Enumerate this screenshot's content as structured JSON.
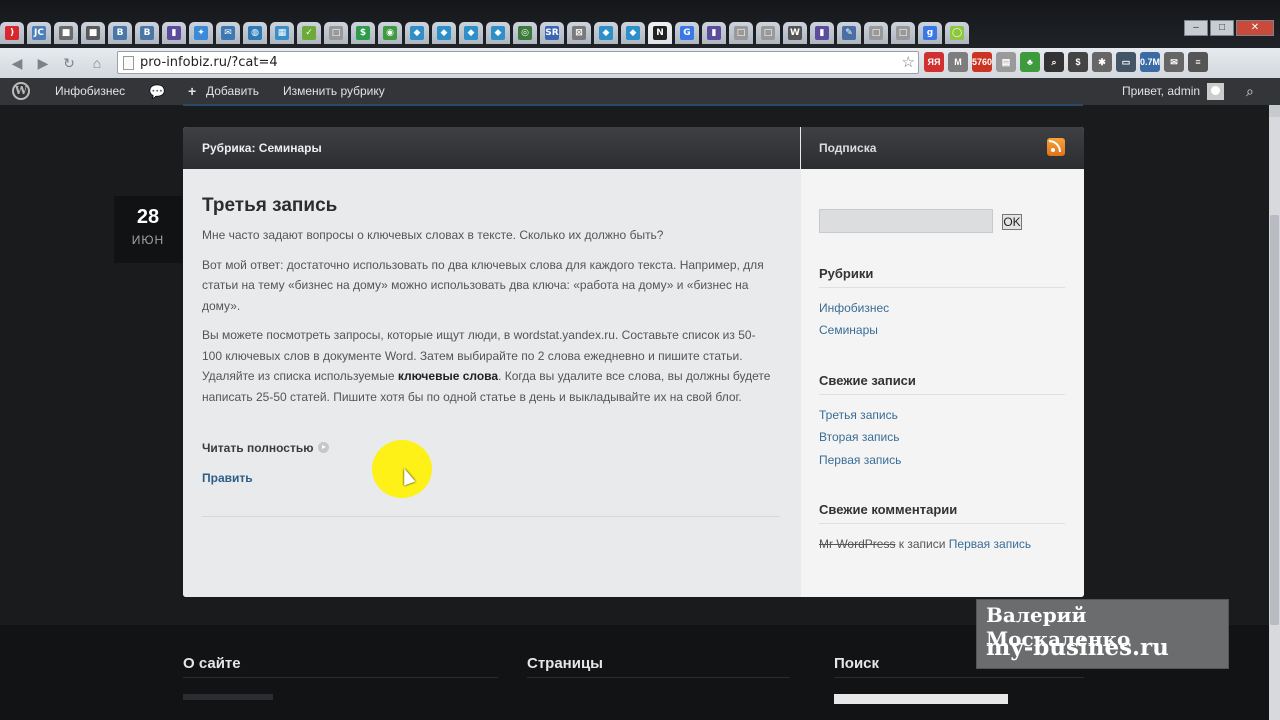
{
  "browser": {
    "tabs": [
      {
        "icon": "opera-icon",
        "glyph": ")",
        "color": "#d8272d"
      },
      {
        "icon": "jc-icon",
        "glyph": "JC",
        "color": "#4d7fb8"
      },
      {
        "icon": "photo-icon",
        "glyph": "■",
        "color": "#6a6a6a"
      },
      {
        "icon": "photo-icon-2",
        "glyph": "■",
        "color": "#5a5a5a"
      },
      {
        "icon": "vk-icon",
        "glyph": "В",
        "color": "#4a76a8"
      },
      {
        "icon": "vk-icon-2",
        "glyph": "В",
        "color": "#4a76a8"
      },
      {
        "icon": "liveinternet-icon",
        "glyph": "▮",
        "color": "#5c4c9c"
      },
      {
        "icon": "google-apps-icon",
        "glyph": "✦",
        "color": "#3b8ad8"
      },
      {
        "icon": "mail-icon",
        "glyph": "✉",
        "color": "#3c78b4"
      },
      {
        "icon": "globe-icon",
        "glyph": "◍",
        "color": "#2c7bb6"
      },
      {
        "icon": "grid-icon",
        "glyph": "▦",
        "color": "#3a8fc9"
      },
      {
        "icon": "leaf-icon",
        "glyph": "✓",
        "color": "#6cab39"
      },
      {
        "icon": "blank-page-icon",
        "glyph": "□",
        "color": "#999999"
      },
      {
        "icon": "dollar-icon",
        "glyph": "$",
        "color": "#2e9b4d"
      },
      {
        "icon": "lock-icon",
        "glyph": "◉",
        "color": "#3f9b40"
      },
      {
        "icon": "diamond-icon",
        "glyph": "◆",
        "color": "#2f8fc9"
      },
      {
        "icon": "diamond-icon-2",
        "glyph": "◆",
        "color": "#2f8fc9"
      },
      {
        "icon": "diamond-icon-3",
        "glyph": "◆",
        "color": "#2f8fc9"
      },
      {
        "icon": "diamond-icon-4",
        "glyph": "◆",
        "color": "#2f8fc9"
      },
      {
        "icon": "camera-icon",
        "glyph": "◎",
        "color": "#3d7a3b"
      },
      {
        "icon": "sr-icon",
        "glyph": "SR",
        "color": "#3a66b3"
      },
      {
        "icon": "cart-icon",
        "glyph": "⊠",
        "color": "#7a7a7a"
      },
      {
        "icon": "diamond-icon-5",
        "glyph": "◆",
        "color": "#2f8fc9"
      },
      {
        "icon": "diamond-icon-6",
        "glyph": "◆",
        "color": "#2f8fc9"
      },
      {
        "icon": "nw-icon",
        "glyph": "N",
        "color": "#222222"
      },
      {
        "icon": "google-icon",
        "glyph": "G",
        "color": "#3b78e7"
      },
      {
        "icon": "liveinternet-icon-2",
        "glyph": "▮",
        "color": "#5c4c9c"
      },
      {
        "icon": "blank-page-icon-2",
        "glyph": "□",
        "color": "#999999"
      },
      {
        "icon": "blank-page-icon-3",
        "glyph": "□",
        "color": "#999999"
      },
      {
        "icon": "wordpress-tab-icon",
        "glyph": "W",
        "color": "#555555"
      },
      {
        "icon": "liveinternet-icon-3",
        "glyph": "▮",
        "color": "#5c4c9c"
      },
      {
        "icon": "quill-icon",
        "glyph": "✎",
        "color": "#4a6fa5"
      },
      {
        "icon": "blank-page-icon-4",
        "glyph": "□",
        "color": "#999999"
      },
      {
        "icon": "blank-page-icon-5",
        "glyph": "□",
        "color": "#999999"
      },
      {
        "icon": "google-plus-icon",
        "glyph": "g",
        "color": "#3b78e7"
      },
      {
        "icon": "lime-icon",
        "glyph": "◯",
        "color": "#8ec63f"
      }
    ],
    "url": "pro-infobiz.ru/?cat=4",
    "extensions": [
      {
        "icon": "yandex-bar-icon",
        "glyph": "ЯЯ",
        "color": "#d03030"
      },
      {
        "icon": "gmail-icon",
        "glyph": "M",
        "color": "#7d7d7d"
      },
      {
        "icon": "counter-icon",
        "glyph": "5760",
        "color": "#cc3322"
      },
      {
        "icon": "page-ext-icon",
        "glyph": "▤",
        "color": "#9a9a9a"
      },
      {
        "icon": "users-icon",
        "glyph": "♣",
        "color": "#3d9a3d"
      },
      {
        "icon": "magnifier-ext-icon",
        "glyph": "⌕",
        "color": "#333333"
      },
      {
        "icon": "dollar-ext-icon",
        "glyph": "$",
        "color": "#444444"
      },
      {
        "icon": "gear-ext-icon",
        "glyph": "✱",
        "color": "#666666"
      },
      {
        "icon": "screen-ext-icon",
        "glyph": "▭",
        "color": "#445566"
      },
      {
        "icon": "stats-ext-icon",
        "glyph": "0.7M",
        "color": "#3b6ba5"
      },
      {
        "icon": "mail-ext-icon",
        "glyph": "✉",
        "color": "#666666"
      },
      {
        "icon": "menu-icon",
        "glyph": "≡",
        "color": "#555555"
      }
    ]
  },
  "adminbar": {
    "site_name": "Инфобизнес",
    "add_label": "Добавить",
    "edit_category_label": "Изменить рубрику",
    "greeting": "Привет, admin"
  },
  "post": {
    "day": "28",
    "month": "ИЮН",
    "category_heading": "Рубрика: Семинары",
    "title": "Третья запись",
    "paragraph1": "Мне часто задают вопросы о ключевых словах в тексте. Сколько их должно быть?",
    "paragraph2": "Вот мой ответ: достаточно использовать по два ключевых слова для каждого текста. Например, для статьи на тему «бизнес на дому» можно использовать два ключа: «работа на дому» и «бизнес на дому».",
    "paragraph3_before": "Вы можете посмотреть запросы, которые ищут люди, в wordstat.yandex.ru. Составьте список из 50-100 ключевых слов в документе Word. Затем выбирайте по 2 слова ежедневно и пишите статьи. Удаляйте из списка используемые ",
    "paragraph3_bold": "ключевые слова",
    "paragraph3_after": ". Когда вы удалите все слова, вы должны будете написать 25-50 статей. Пишите хотя бы по одной статье в день и выкладывайте их на свой блог.",
    "read_more": "Читать полностью",
    "edit_link": "Править"
  },
  "sidebar": {
    "subscribe_heading": "Подписка",
    "search_button": "OK",
    "categories_title": "Рубрики",
    "categories": [
      "Инфобизнес",
      "Семинары"
    ],
    "recent_posts_title": "Свежие записи",
    "recent_posts": [
      "Третья запись",
      "Вторая запись",
      "Первая запись"
    ],
    "recent_comments_title": "Свежие комментарии",
    "comment_author": "Mr WordPress",
    "comment_mid": " к записи ",
    "comment_post": "Первая запись"
  },
  "footer": {
    "about_title": "О сайте",
    "pages_title": "Страницы",
    "search_title": "Поиск"
  },
  "watermark": {
    "line1": "Валерий Москаленко",
    "line2": "my-busines.ru"
  }
}
